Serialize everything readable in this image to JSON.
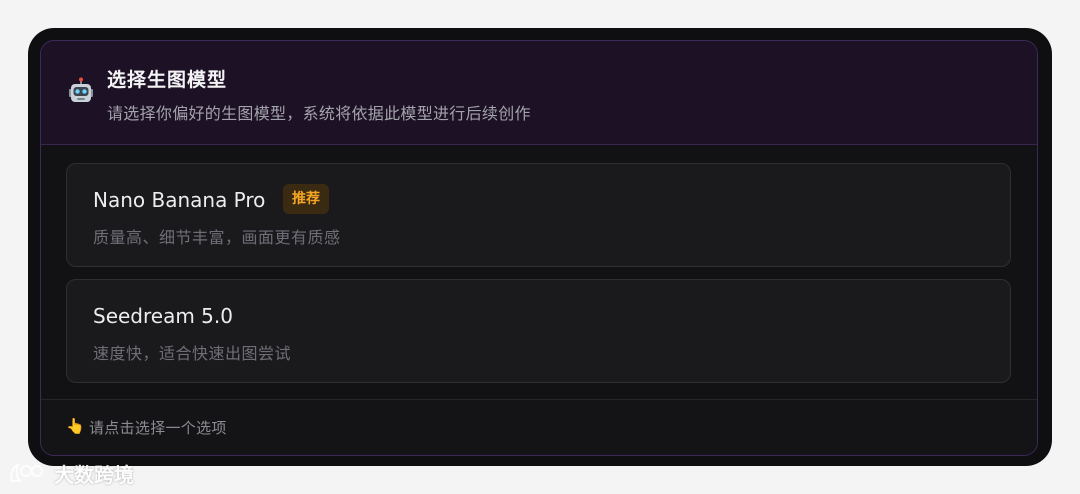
{
  "header": {
    "icon": "robot-icon",
    "title": "选择生图模型",
    "subtitle": "请选择你偏好的生图模型，系统将依据此模型进行后续创作"
  },
  "options": [
    {
      "title": "Nano Banana Pro",
      "badge": "推荐",
      "desc": "质量高、细节丰富，画面更有质感"
    },
    {
      "title": "Seedream 5.0",
      "desc": "速度快，适合快速出图尝试"
    }
  ],
  "footer": {
    "icon": "pointing-hand-icon",
    "hint": "请点击选择一个选项"
  },
  "watermark": {
    "text": "大数跨境"
  },
  "colors": {
    "accent_border": "#3d2a5c",
    "header_bg": "#1d1125",
    "badge_text": "#f5a524",
    "badge_bg": "#3b2a12"
  }
}
